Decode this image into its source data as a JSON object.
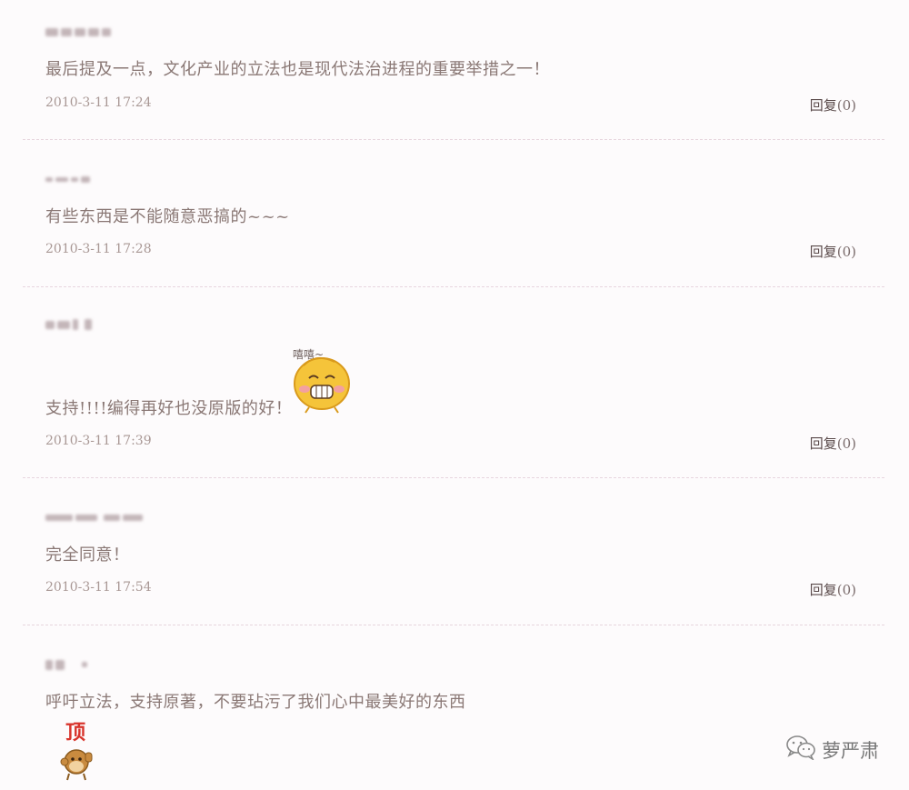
{
  "comments": [
    {
      "author_name": "",
      "content": "最后提及一点，文化产业的立法也是现代法治进程的重要举措之一！",
      "time": "2010-3-11  17:24",
      "reply_label": "回复",
      "reply_count": "(0)"
    },
    {
      "author_name": "",
      "content": "有些东西是不能随意恶搞的~~~",
      "time": "2010-3-11  17:28",
      "reply_label": "回复",
      "reply_count": "(0)"
    },
    {
      "author_name": "",
      "content": "支持!!!!编得再好也没原版的好！",
      "time": "2010-3-11  17:39",
      "reply_label": "回复",
      "reply_count": "(0)",
      "emoticon": {
        "icon": "grinning-bun-emoticon",
        "caption": "嘻嘻~"
      }
    },
    {
      "author_name": "",
      "content": "完全同意！",
      "time": "2010-3-11  17:54",
      "reply_label": "回复",
      "reply_count": "(0)"
    },
    {
      "author_name": "",
      "content": "呼吁立法，支持原著，不要玷污了我们心中最美好的东西",
      "emoticon": {
        "icon": "monkey-thumbs-up-emoticon",
        "caption": "顶"
      }
    }
  ],
  "watermark": {
    "icon": "wechat-icon",
    "text": "萝严肃"
  },
  "colors": {
    "background": "#fdfbfc",
    "text": "#8a7875",
    "divider": "#e7d5de",
    "reply": "#5a4a4a"
  }
}
